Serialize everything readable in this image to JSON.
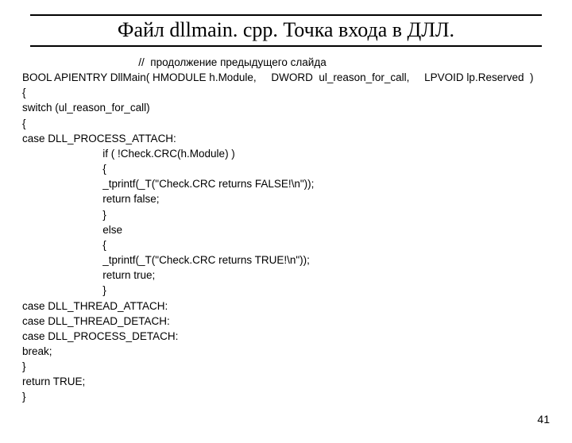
{
  "title": "Файл dllmain. cpp. Точка входа в ДЛЛ.",
  "code": "                                       //  продолжение предыдущего слайда\nBOOL APIENTRY DllMain( HMODULE h.Module,     DWORD  ul_reason_for_call,     LPVOID lp.Reserved  )\n{\nswitch (ul_reason_for_call)\n{\ncase DLL_PROCESS_ATTACH:\n                           if ( !Check.CRC(h.Module) )\n                           {\n                           _tprintf(_T(\"Check.CRC returns FALSE!\\n\"));\n                           return false;\n                           }\n                           else\n                           {\n                           _tprintf(_T(\"Check.CRC returns TRUE!\\n\"));\n                           return true;\n                           }\ncase DLL_THREAD_ATTACH:\ncase DLL_THREAD_DETACH:\ncase DLL_PROCESS_DETACH:\nbreak;\n}\nreturn TRUE;\n}",
  "pageNumber": "41"
}
